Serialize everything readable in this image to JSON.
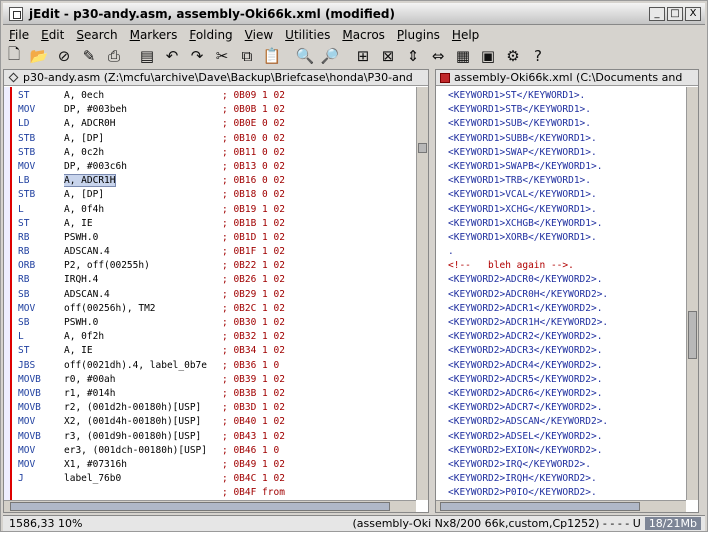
{
  "window": {
    "title": "jEdit - p30-andy.asm, assembly-Oki66k.xml (modified)",
    "controls": [
      "_",
      "□",
      "X"
    ]
  },
  "menu": {
    "items": [
      {
        "u": "F",
        "rest": "ile"
      },
      {
        "u": "E",
        "rest": "dit"
      },
      {
        "u": "S",
        "rest": "earch"
      },
      {
        "u": "M",
        "rest": "arkers"
      },
      {
        "u": "F",
        "rest": "olding"
      },
      {
        "u": "V",
        "rest": "iew"
      },
      {
        "u": "U",
        "rest": "tilities"
      },
      {
        "u": "M",
        "rest": "acros"
      },
      {
        "u": "P",
        "rest": "lugins"
      },
      {
        "u": "H",
        "rest": "elp"
      }
    ]
  },
  "toolbar": {
    "icons": [
      {
        "name": "new-file-icon",
        "glyph": "🗋"
      },
      {
        "name": "open-file-icon",
        "glyph": "📂"
      },
      {
        "name": "close-file-icon",
        "glyph": "⊘"
      },
      {
        "name": "edit-pencil-icon",
        "glyph": "✎"
      },
      {
        "name": "print-icon",
        "glyph": "⎙"
      },
      {
        "name": "save-icon",
        "glyph": "▤"
      },
      {
        "name": "undo-icon",
        "glyph": "↶"
      },
      {
        "name": "redo-icon",
        "glyph": "↷"
      },
      {
        "name": "cut-icon",
        "glyph": "✂"
      },
      {
        "name": "copy-icon",
        "glyph": "⧉"
      },
      {
        "name": "paste-icon",
        "glyph": "📋"
      },
      {
        "name": "find-icon",
        "glyph": "🔍"
      },
      {
        "name": "find-next-icon",
        "glyph": "🔎"
      },
      {
        "name": "split-icon",
        "glyph": "⊞"
      },
      {
        "name": "unsplit-icon",
        "glyph": "⊠"
      },
      {
        "name": "split-vertical-icon",
        "glyph": "⇕"
      },
      {
        "name": "split-horizontal-icon",
        "glyph": "⇔"
      },
      {
        "name": "buffer-options-icon",
        "glyph": "▦"
      },
      {
        "name": "global-options-icon",
        "glyph": "▣"
      },
      {
        "name": "plugin-manager-icon",
        "glyph": "⚙"
      },
      {
        "name": "help-icon",
        "glyph": "?"
      }
    ]
  },
  "left_pane": {
    "buffer": "p30-andy.asm (Z:\\mcfu\\archive\\Dave\\Backup\\Briefcase\\honda\\P30-and",
    "lines": [
      {
        "op": "ST",
        "args": "A, 0ech",
        "comment": "; 0B09 1 02"
      },
      {
        "op": "MOV",
        "args": "DP, #003beh",
        "comment": "; 0B0B 1 02"
      },
      {
        "op": "LD",
        "args": "A, ADCR0H",
        "comment": "; 0B0E 0 02"
      },
      {
        "op": "STB",
        "args": "A, [DP]",
        "comment": "; 0B10 0 02"
      },
      {
        "op": "STB",
        "args": "A, 0c2h",
        "comment": "; 0B11 0 02"
      },
      {
        "op": "MOV",
        "args": "DP, #003c6h",
        "comment": "; 0B13 0 02"
      },
      {
        "op": "LB",
        "args": "A, ADCR1H",
        "comment": "; 0B16 0 02",
        "hl": true
      },
      {
        "op": "STB",
        "args": "A, [DP]",
        "comment": "; 0B18 0 02"
      },
      {
        "op": "L",
        "args": "A, 0f4h",
        "comment": "; 0B19 1 02"
      },
      {
        "op": "ST",
        "args": "A, IE",
        "comment": "; 0B1B 1 02"
      },
      {
        "op": "RB",
        "args": "PSWH.0",
        "comment": "; 0B1D 1 02"
      },
      {
        "op": "RB",
        "args": "ADSCAN.4",
        "comment": "; 0B1F 1 02"
      },
      {
        "op": "ORB",
        "args": "P2, off(00255h)",
        "comment": "; 0B22 1 02"
      },
      {
        "op": "RB",
        "args": "IRQH.4",
        "comment": "; 0B26 1 02"
      },
      {
        "op": "SB",
        "args": "ADSCAN.4",
        "comment": "; 0B29 1 02"
      },
      {
        "op": "MOV",
        "args": "off(00256h), TM2",
        "comment": "; 0B2C 1 02"
      },
      {
        "op": "SB",
        "args": "PSWH.0",
        "comment": "; 0B30 1 02"
      },
      {
        "op": "L",
        "args": "A, 0f2h",
        "comment": "; 0B32 1 02"
      },
      {
        "op": "ST",
        "args": "A, IE",
        "comment": "; 0B34 1 02"
      },
      {
        "op": "JBS",
        "args": "off(0021dh).4, label_0b7e",
        "comment": "; 0B36 1 0"
      },
      {
        "op": "MOVB",
        "args": "r0, #00ah",
        "comment": "; 0B39 1 02"
      },
      {
        "op": "MOVB",
        "args": "r1, #014h",
        "comment": "; 0B3B 1 02"
      },
      {
        "op": "MOVB",
        "args": "r2, (001d2h-00180h)[USP]",
        "comment": "; 0B3D 1 02"
      },
      {
        "op": "MOV",
        "args": "X2, (001d4h-00180h)[USP]",
        "comment": "; 0B40 1 02"
      },
      {
        "op": "MOVB",
        "args": "r3, (001d9h-00180h)[USP]",
        "comment": "; 0B43 1 02"
      },
      {
        "op": "MOV",
        "args": "er3, (001dch-00180h)[USP]",
        "comment": "; 0B46 1 0"
      },
      {
        "op": "MOV",
        "args": "X1, #07316h",
        "comment": "; 0B49 1 02"
      },
      {
        "op": "J",
        "args": "label_76b0",
        "comment": "; 0B4C 1 02"
      },
      {
        "op": "",
        "args": "",
        "comment": "; 0B4F from"
      }
    ]
  },
  "right_pane": {
    "buffer": "assembly-Oki66k.xml (C:\\Documents and",
    "lines": [
      {
        "text": "<KEYWORD1>ST</KEYWORD1>."
      },
      {
        "text": "<KEYWORD1>STB</KEYWORD1>."
      },
      {
        "text": "<KEYWORD1>SUB</KEYWORD1>."
      },
      {
        "text": "<KEYWORD1>SUBB</KEYWORD1>."
      },
      {
        "text": "<KEYWORD1>SWAP</KEYWORD1>."
      },
      {
        "text": "<KEYWORD1>SWAPB</KEYWORD1>."
      },
      {
        "text": "<KEYWORD1>TRB</KEYWORD1>."
      },
      {
        "text": "<KEYWORD1>VCAL</KEYWORD1>."
      },
      {
        "text": "<KEYWORD1>XCHG</KEYWORD1>."
      },
      {
        "text": "<KEYWORD1>XCHGB</KEYWORD1>."
      },
      {
        "text": "<KEYWORD1>XORB</KEYWORD1>."
      },
      {
        "text": "."
      },
      {
        "text": "<!--   bleh again -->.",
        "comment": true
      },
      {
        "text": "<KEYWORD2>ADCR0</KEYWORD2>."
      },
      {
        "text": "<KEYWORD2>ADCR0H</KEYWORD2>."
      },
      {
        "text": "<KEYWORD2>ADCR1</KEYWORD2>."
      },
      {
        "text": "<KEYWORD2>ADCR1H</KEYWORD2>."
      },
      {
        "text": "<KEYWORD2>ADCR2</KEYWORD2>."
      },
      {
        "text": "<KEYWORD2>ADCR3</KEYWORD2>."
      },
      {
        "text": "<KEYWORD2>ADCR4</KEYWORD2>."
      },
      {
        "text": "<KEYWORD2>ADCR5</KEYWORD2>."
      },
      {
        "text": "<KEYWORD2>ADCR6</KEYWORD2>."
      },
      {
        "text": "<KEYWORD2>ADCR7</KEYWORD2>."
      },
      {
        "text": "<KEYWORD2>ADSCAN</KEYWORD2>."
      },
      {
        "text": "<KEYWORD2>ADSEL</KEYWORD2>."
      },
      {
        "text": "<KEYWORD2>EXION</KEYWORD2>."
      },
      {
        "text": "<KEYWORD2>IRQ</KEYWORD2>."
      },
      {
        "text": "<KEYWORD2>IRQH</KEYWORD2>."
      },
      {
        "text": "<KEYWORD2>P0IO</KEYWORD2>."
      }
    ]
  },
  "status": {
    "position": "1586,33 10%",
    "mode": "(assembly-Oki Nx8/200 66k,custom,Cp1252) - - - - U",
    "memory": "18/21Mb"
  }
}
